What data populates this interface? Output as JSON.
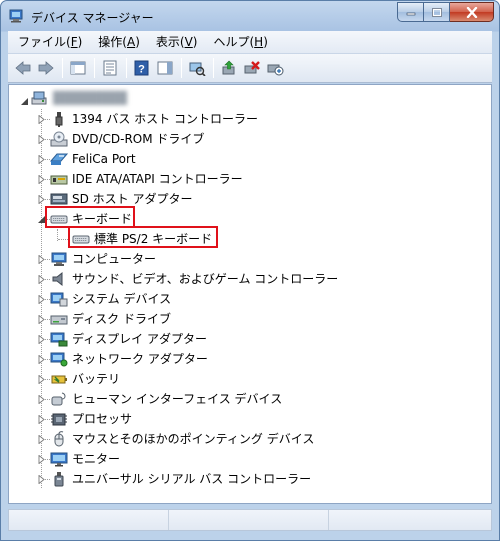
{
  "window": {
    "title": "デバイス マネージャー"
  },
  "menubar": {
    "items": [
      {
        "label": "ファイル(",
        "key": "F",
        "suffix": ")"
      },
      {
        "label": "操作(",
        "key": "A",
        "suffix": ")"
      },
      {
        "label": "表示(",
        "key": "V",
        "suffix": ")"
      },
      {
        "label": "ヘルプ(",
        "key": "H",
        "suffix": ")"
      }
    ]
  },
  "tree": {
    "root": {
      "label": "████████"
    },
    "categories": [
      {
        "label": "1394 バス ホスト コントローラー",
        "icon": "usb-plug-icon",
        "expanded": false
      },
      {
        "label": "DVD/CD-ROM ドライブ",
        "icon": "disc-drive-icon",
        "expanded": false
      },
      {
        "label": "FeliCa Port",
        "icon": "felica-icon",
        "expanded": false
      },
      {
        "label": "IDE ATA/ATAPI コントローラー",
        "icon": "ide-controller-icon",
        "expanded": false
      },
      {
        "label": "SD ホスト アダプター",
        "icon": "sd-adapter-icon",
        "expanded": false
      },
      {
        "label": "キーボード",
        "icon": "keyboard-icon",
        "expanded": true,
        "children": [
          {
            "label": "標準 PS/2 キーボード",
            "icon": "keyboard-icon"
          }
        ]
      },
      {
        "label": "コンピューター",
        "icon": "computer-icon",
        "expanded": false
      },
      {
        "label": "サウンド、ビデオ、およびゲーム コントローラー",
        "icon": "speaker-icon",
        "expanded": false
      },
      {
        "label": "システム デバイス",
        "icon": "system-device-icon",
        "expanded": false
      },
      {
        "label": "ディスク ドライブ",
        "icon": "disk-drive-icon",
        "expanded": false
      },
      {
        "label": "ディスプレイ アダプター",
        "icon": "display-adapter-icon",
        "expanded": false
      },
      {
        "label": "ネットワーク アダプター",
        "icon": "network-adapter-icon",
        "expanded": false
      },
      {
        "label": "バッテリ",
        "icon": "battery-icon",
        "expanded": false
      },
      {
        "label": "ヒューマン インターフェイス デバイス",
        "icon": "hid-icon",
        "expanded": false
      },
      {
        "label": "プロセッサ",
        "icon": "processor-icon",
        "expanded": false
      },
      {
        "label": "マウスとそのほかのポインティング デバイス",
        "icon": "mouse-icon",
        "expanded": false
      },
      {
        "label": "モニター",
        "icon": "monitor-icon",
        "expanded": false
      },
      {
        "label": "ユニバーサル シリアル バス コントローラー",
        "icon": "usb-icon",
        "expanded": false
      }
    ]
  },
  "colors": {
    "highlight_border": "#e0111a",
    "title_bar": "#b9d1ea",
    "close_button": "#c9452d"
  }
}
